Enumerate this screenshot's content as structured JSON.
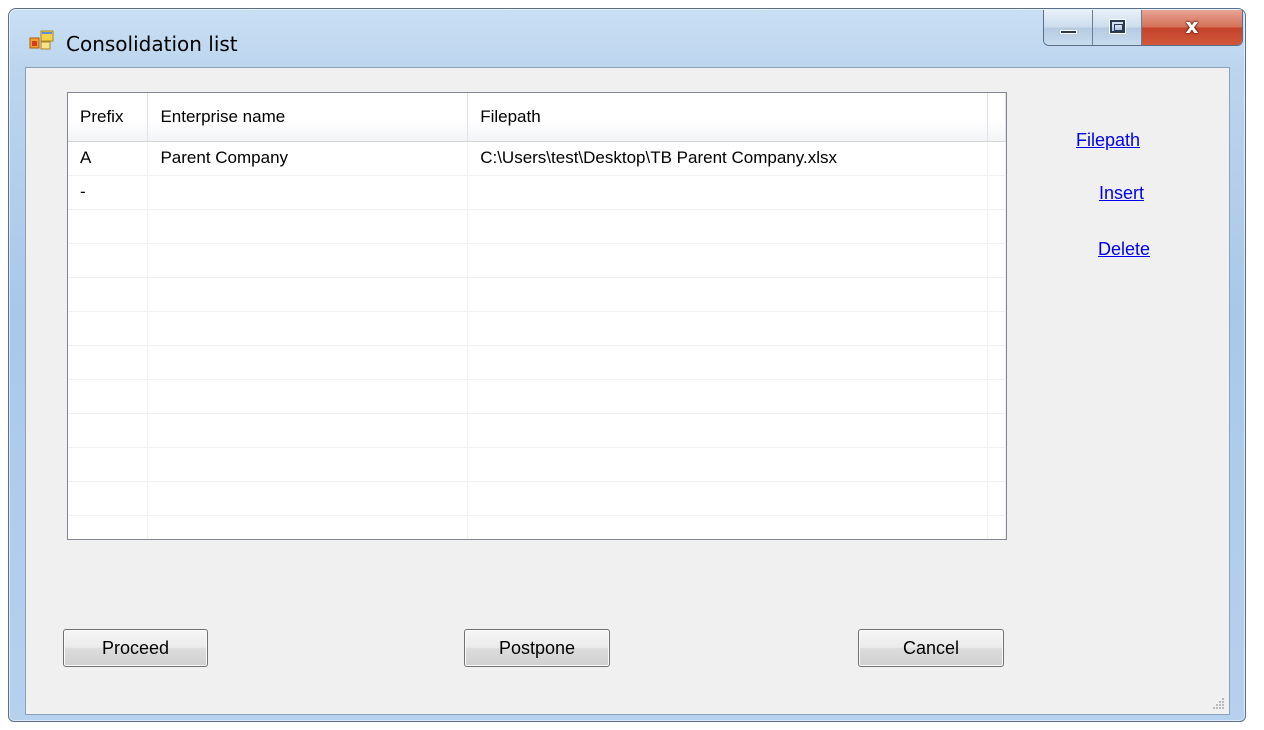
{
  "window": {
    "title": "Consolidation list",
    "controls": {
      "minimize": "minimize",
      "maximize": "maximize",
      "close": "x"
    }
  },
  "grid": {
    "columns": [
      "Prefix",
      "Enterprise name",
      "Filepath"
    ],
    "rows": [
      {
        "prefix": "A",
        "name": "Parent Company",
        "filepath": "C:\\Users\\test\\Desktop\\TB Parent Company.xlsx"
      },
      {
        "prefix": "-",
        "name": "",
        "filepath": ""
      }
    ]
  },
  "links": {
    "filepath": "Filepath",
    "insert": "Insert",
    "delete": "Delete"
  },
  "buttons": {
    "proceed": "Proceed",
    "postpone": "Postpone",
    "cancel": "Cancel"
  },
  "colors": {
    "link": "#0000ee",
    "close_button": "#c3432b",
    "client_bg": "#f0f0f0",
    "title_bar": "#bcd5ee"
  },
  "icons": {
    "app": "app-window-icon",
    "resize": "size-grip-icon"
  }
}
